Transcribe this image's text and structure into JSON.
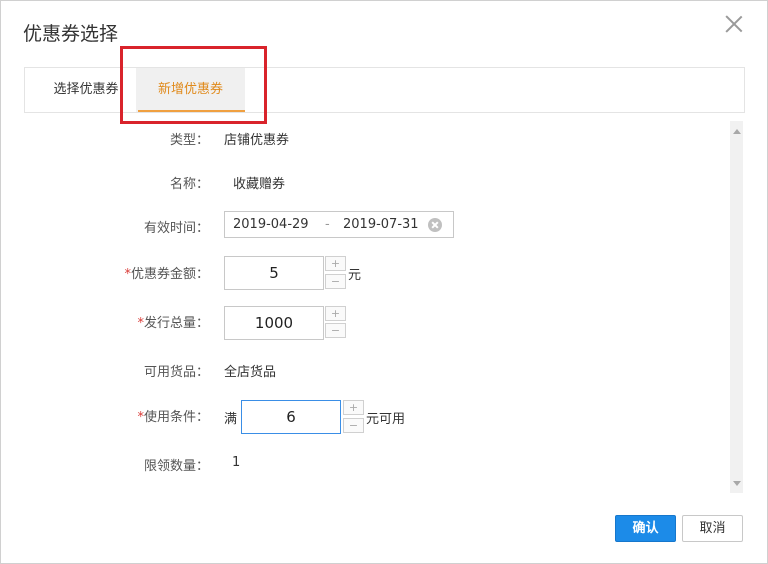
{
  "dialog": {
    "title": "优惠券选择"
  },
  "tabs": [
    {
      "label": "选择优惠券",
      "active": false
    },
    {
      "label": "新增优惠券",
      "active": true
    }
  ],
  "form": {
    "type": {
      "label": "类型：",
      "value": "店铺优惠券"
    },
    "name": {
      "label": "名称：",
      "value": "收藏赠券"
    },
    "valid_time": {
      "label": "有效时间：",
      "start": "2019-04-29",
      "separator": "-",
      "end": "2019-07-31"
    },
    "amount": {
      "label": "优惠券金额：",
      "value": "5",
      "unit": "元"
    },
    "total": {
      "label": "发行总量：",
      "value": "1000"
    },
    "goods": {
      "label": "可用货品：",
      "value": "全店货品"
    },
    "condition": {
      "label": "使用条件：",
      "prefix": "满",
      "value": "6",
      "suffix": "元可用"
    },
    "limit": {
      "label": "限领数量：",
      "value": "1"
    }
  },
  "stepper": {
    "plus": "+",
    "minus": "−"
  },
  "required_mark": "*",
  "buttons": {
    "confirm": "确认",
    "cancel": "取消"
  },
  "colors": {
    "accent_orange": "#e08a1b",
    "highlight_red": "#d9232b",
    "primary_blue": "#1c8be8",
    "required_red": "#d93a36"
  }
}
